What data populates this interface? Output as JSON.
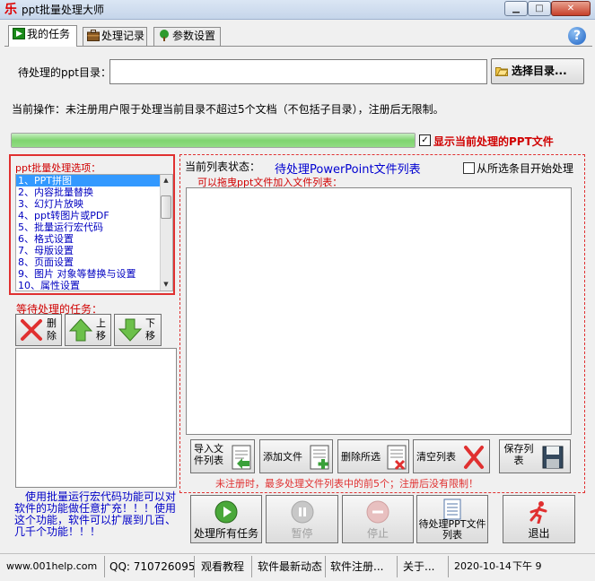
{
  "window": {
    "app_icon_glyph": "乐",
    "title": "ppt批量处理大师",
    "minimize_glyph": "▁",
    "maximize_glyph": "□",
    "close_glyph": "✕"
  },
  "tabs": [
    {
      "label": "我的任务",
      "icon": "play-icon",
      "active": true
    },
    {
      "label": "处理记录",
      "icon": "briefcase-icon",
      "active": false
    },
    {
      "label": "参数设置",
      "icon": "tree-icon",
      "active": false
    }
  ],
  "help_glyph": "?",
  "directory": {
    "label": "待处理的ppt目录：",
    "value": "",
    "placeholder": "",
    "select_button": "选择目录..."
  },
  "operation_text": "当前操作：未注册用户限于处理当前目录不超过5个文档（不包括子目录），注册后无限制。",
  "progress": {
    "fraction": 1.0
  },
  "show_current": {
    "checked": true,
    "check_glyph": "✓",
    "label": "显示当前处理的PPT文件"
  },
  "options": {
    "title": "ppt批量处理选项：",
    "items": [
      "1、PPT拼图",
      "2、内容批量替换",
      "3、幻灯片放映",
      "4、ppt转图片或PDF",
      "5、批量运行宏代码",
      "6、格式设置",
      "7、母版设置",
      "8、页面设置",
      "9、图片 对象等替换与设置",
      "10、属性设置"
    ],
    "selected_index": 0,
    "scroll_up_glyph": "▲",
    "scroll_down_glyph": "▼"
  },
  "pending": {
    "title": "等待处理的任务：",
    "delete_label": "删除",
    "up_label": "上移",
    "down_label": "下移"
  },
  "promo_text": "　使用批量运行宏代码功能可以对软件的功能做任意扩充！！！使用这个功能，软件可以扩展到几百、几千个功能！！！",
  "file_list": {
    "status_label": "当前列表状态：",
    "status_value": "待处理PowerPoint文件列表",
    "from_selected_label": "从所选条目开始处理",
    "from_selected_checked": false,
    "drag_hint": "可以拖曳ppt文件加入文件列表：",
    "import_label": "导入文件列表",
    "add_label": "添加文件",
    "remove_label": "删除所选",
    "clear_label": "清空列表",
    "save_label": "保存列表",
    "limit_hint": "未注册时，最多处理文件列表中的前5个；注册后没有限制！"
  },
  "actions": {
    "run_all": "处理所有任务",
    "pause": "暂停",
    "stop": "停止",
    "pending_ppt": "待处理PPT文件列表",
    "exit": "退出"
  },
  "statusbar": {
    "site": "www.001help.com",
    "qq": "QQ: 710726095",
    "tutorial": "观看教程",
    "news": "软件最新动态",
    "register": "软件注册...",
    "about": "关于...",
    "date": "2020-10-14",
    "time": "下午 9"
  },
  "colors": {
    "red_text": "#d00000",
    "blue_text": "#0000c8",
    "selection": "#3399ff",
    "progress_green": "#7fd36f"
  }
}
